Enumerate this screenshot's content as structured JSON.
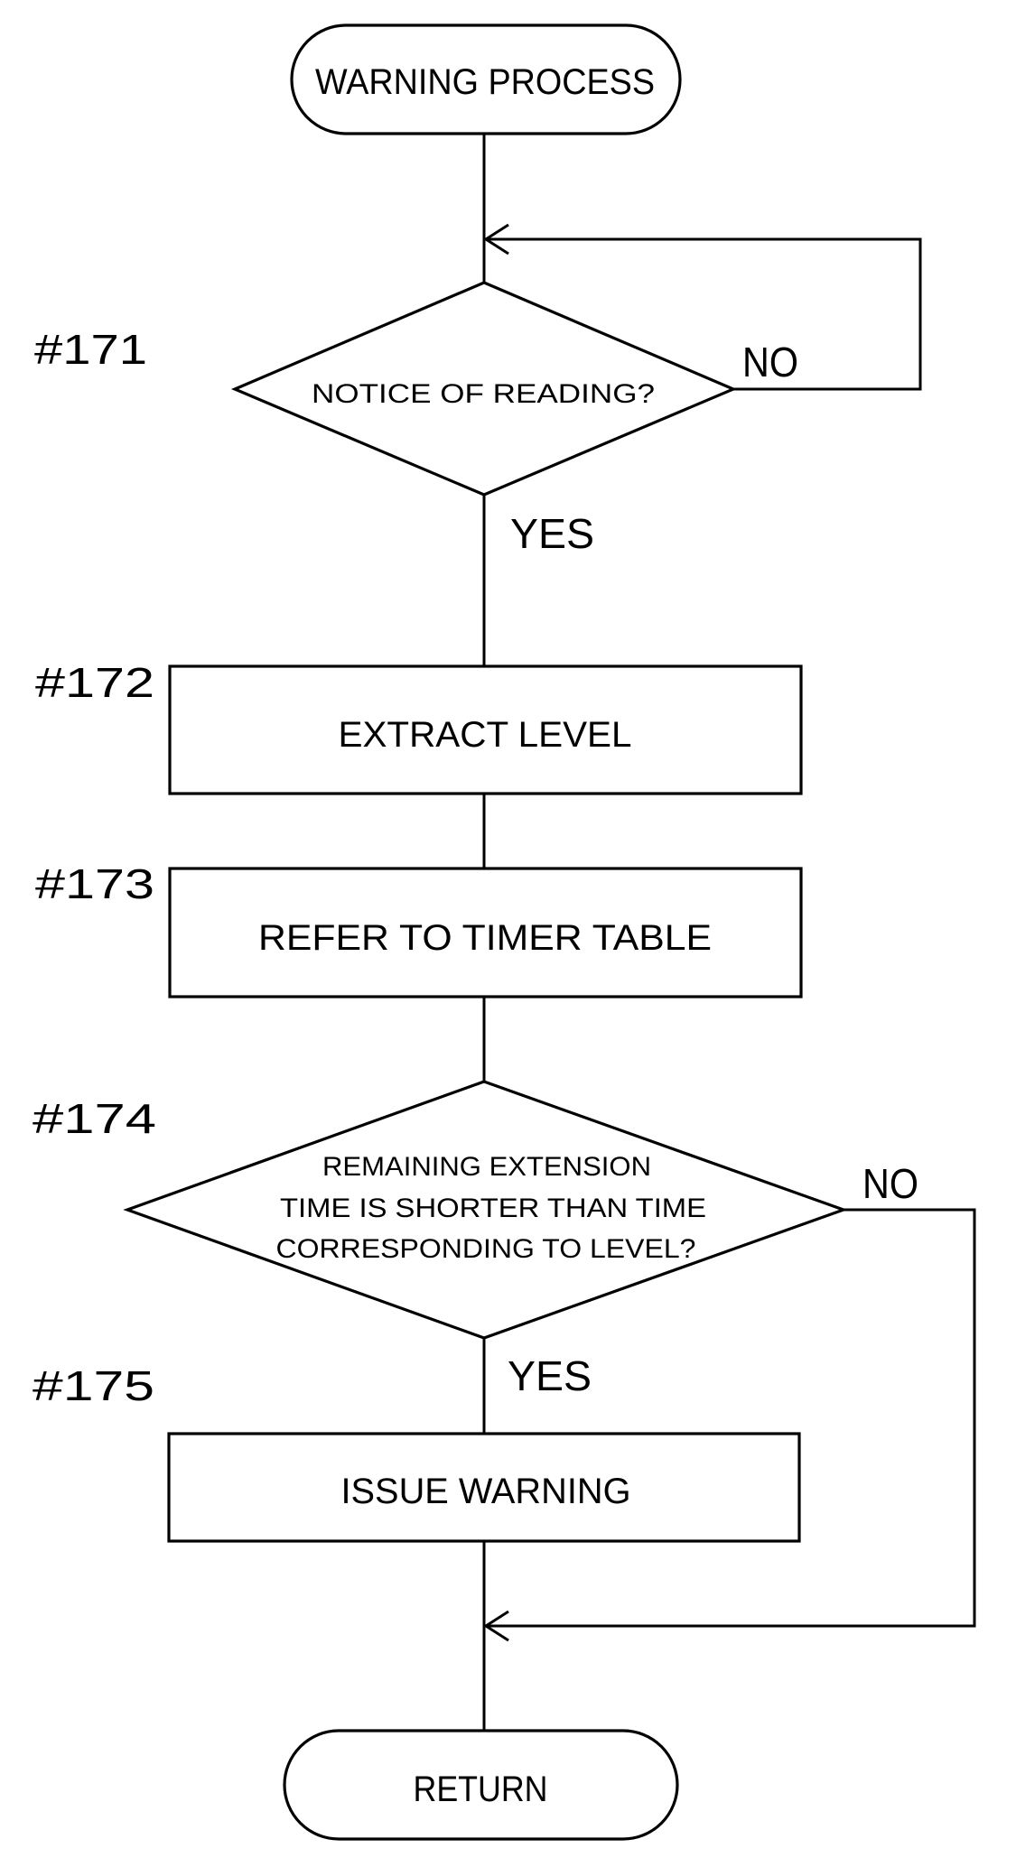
{
  "title": "WARNING PROCESS",
  "nodes": {
    "start": {
      "text": "WARNING PROCESS"
    },
    "s171": {
      "step": "#171",
      "text": "NOTICE OF READING?",
      "no_label": "NO",
      "yes_label": "YES"
    },
    "s172": {
      "step": "#172",
      "text": "EXTRACT LEVEL"
    },
    "s173": {
      "step": "#173",
      "text": "REFER TO TIMER TABLE"
    },
    "s174": {
      "step": "#174",
      "lines": [
        "REMAINING EXTENSION",
        "TIME IS SHORTER THAN TIME",
        "CORRESPONDING TO LEVEL?"
      ],
      "no_label": "NO",
      "yes_label": "YES"
    },
    "s175": {
      "step": "#175",
      "text": "ISSUE WARNING"
    },
    "end": {
      "text": "RETURN"
    }
  },
  "colors": {
    "ink": "#000000",
    "paper": "#ffffff"
  }
}
